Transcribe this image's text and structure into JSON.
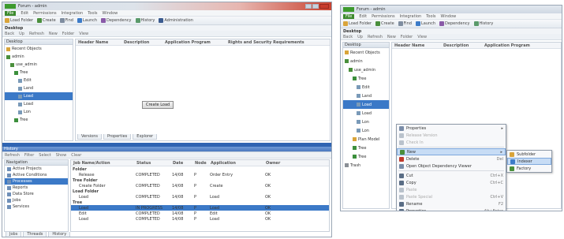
{
  "left_window": {
    "title": "Forum - admin",
    "menu": [
      "File",
      "Edit",
      "Permissions",
      "Integration",
      "Tools",
      "Window"
    ],
    "toolbar": [
      {
        "label": "Load Folder",
        "icon": "folder-icon",
        "color": "#d9a43a"
      },
      {
        "label": "Create",
        "icon": "create-icon",
        "color": "#4a8f3c"
      },
      {
        "label": "Find",
        "icon": "find-icon",
        "color": "#7f8da0"
      },
      {
        "label": "Launch",
        "icon": "launch-icon",
        "color": "#3c7bc8"
      },
      {
        "label": "Dependency",
        "icon": "dependency-icon",
        "color": "#8a5aa8"
      },
      {
        "label": "History",
        "icon": "history-icon",
        "color": "#5a9a6a"
      },
      {
        "label": "Administration",
        "icon": "admin-icon",
        "color": "#3b5b8f"
      }
    ],
    "doc_title": "Desktop",
    "subtoolbar": [
      "Back",
      "Up",
      "Refresh",
      "New",
      "Folder",
      "View"
    ],
    "tree_header": "Desktop",
    "tree": [
      {
        "label": "Recent Objects",
        "icon": "recent-icon",
        "color": "#d9a43a",
        "indent": 0
      },
      {
        "label": "admin",
        "icon": "user-folder-icon",
        "color": "#4a8f3c",
        "indent": 0
      },
      {
        "label": "use_admin",
        "icon": "folder-icon",
        "color": "#4a8f3c",
        "indent": 1
      },
      {
        "label": "Tree",
        "icon": "tree-icon",
        "color": "#3c8f3c",
        "indent": 2
      },
      {
        "label": "Edit",
        "icon": "doc-icon",
        "color": "#7a9ab8",
        "indent": 3
      },
      {
        "label": "Land",
        "icon": "doc-icon",
        "color": "#7a9ab8",
        "indent": 3
      },
      {
        "label": "Load",
        "icon": "doc-icon",
        "color": "#7a9ab8",
        "indent": 3,
        "selected": true
      },
      {
        "label": "Load",
        "icon": "doc-icon",
        "color": "#7a9ab8",
        "indent": 3
      },
      {
        "label": "Lon",
        "icon": "doc-icon",
        "color": "#7a9ab8",
        "indent": 3
      },
      {
        "label": "Tree",
        "icon": "tree-icon",
        "color": "#3c8f3c",
        "indent": 2
      }
    ],
    "list_columns": [
      "Header Name",
      "Description",
      "Application Program",
      "Rights and Security Requirements"
    ],
    "center_button": "Create Load",
    "bottom_tabs": [
      "Versions",
      "Properties",
      "Explorer"
    ],
    "lower_panel": {
      "title": "History",
      "toolbar": [
        "Refresh",
        "Filter",
        "Select",
        "Show",
        "Clear"
      ],
      "nav_header": "Navigation",
      "nav_items": [
        "Active Projects",
        "Active Conditions",
        "Processes",
        "Reports",
        "Data Store",
        "Jobs",
        "Services"
      ],
      "columns": [
        "Job Name/Action",
        "Status",
        "Date",
        "Node",
        "Application",
        "Owner"
      ],
      "rows": [
        {
          "group": true,
          "cells": [
            "Folder"
          ]
        },
        {
          "group": false,
          "cells": [
            "Release",
            "COMPLETED",
            "14/08",
            "P",
            "Order Entry",
            "OK"
          ]
        },
        {
          "group": true,
          "cells": [
            "Tree Folder"
          ]
        },
        {
          "group": false,
          "cells": [
            "Create Folder",
            "COMPLETED",
            "14/08",
            "P",
            "Create",
            "OK"
          ]
        },
        {
          "group": true,
          "cells": [
            "Load Folder"
          ]
        },
        {
          "group": false,
          "cells": [
            "Load",
            "COMPLETED",
            "14/08",
            "P",
            "Load",
            "OK"
          ]
        },
        {
          "group": true,
          "cells": [
            "Tree"
          ]
        },
        {
          "group": false,
          "cells": [
            "Load",
            "IN PROGRESS",
            "14/08",
            "P",
            "Load",
            "OK"
          ],
          "selected": true
        },
        {
          "group": false,
          "cells": [
            "Edit",
            "COMPLETED",
            "14/08",
            "P",
            "Edit",
            "OK"
          ]
        },
        {
          "group": false,
          "cells": [
            "Load",
            "COMPLETED",
            "14/08",
            "P",
            "Load",
            "OK"
          ]
        }
      ],
      "status_tabs": [
        "Jobs",
        "Threads",
        "History"
      ]
    }
  },
  "right_window": {
    "title": "Forum - admin",
    "menu": [
      "File",
      "Edit",
      "Permissions",
      "Integration",
      "Tools",
      "Window"
    ],
    "toolbar": [
      {
        "label": "Load Folder",
        "icon": "folder-icon",
        "color": "#d9a43a"
      },
      {
        "label": "Create",
        "icon": "create-icon",
        "color": "#4a8f3c"
      },
      {
        "label": "Find",
        "icon": "find-icon",
        "color": "#7f8da0"
      },
      {
        "label": "Launch",
        "icon": "launch-icon",
        "color": "#3c7bc8"
      },
      {
        "label": "Dependency",
        "icon": "dependency-icon",
        "color": "#8a5aa8"
      },
      {
        "label": "History",
        "icon": "history-icon",
        "color": "#5a9a6a"
      }
    ],
    "doc_title": "Desktop",
    "subtoolbar": [
      "Back",
      "Up",
      "Refresh",
      "New",
      "Folder",
      "View"
    ],
    "tree_header": "Desktop",
    "tree": [
      {
        "label": "Recent Objects",
        "icon": "recent-icon",
        "color": "#d9a43a",
        "indent": 0
      },
      {
        "label": "admin",
        "icon": "user-folder-icon",
        "color": "#4a8f3c",
        "indent": 0
      },
      {
        "label": "use_admin",
        "icon": "folder-icon",
        "color": "#4a8f3c",
        "indent": 1
      },
      {
        "label": "Tree",
        "icon": "tree-icon",
        "color": "#3c8f3c",
        "indent": 2
      },
      {
        "label": "Edit",
        "icon": "doc-icon",
        "color": "#7a9ab8",
        "indent": 3
      },
      {
        "label": "Land",
        "icon": "doc-icon",
        "color": "#7a9ab8",
        "indent": 3
      },
      {
        "label": "Load",
        "icon": "doc-icon",
        "color": "#7a9ab8",
        "indent": 3,
        "selected": true
      },
      {
        "label": "Load",
        "icon": "doc-icon",
        "color": "#7a9ab8",
        "indent": 3
      },
      {
        "label": "Lon",
        "icon": "doc-icon",
        "color": "#7a9ab8",
        "indent": 3
      },
      {
        "label": "Lon",
        "icon": "doc-icon",
        "color": "#7a9ab8",
        "indent": 3
      },
      {
        "label": "Plan Model",
        "icon": "model-icon",
        "color": "#d9a43a",
        "indent": 2
      },
      {
        "label": "Tree",
        "icon": "tree-icon",
        "color": "#3c8f3c",
        "indent": 2
      },
      {
        "label": "Tree",
        "icon": "tree-icon",
        "color": "#3c8f3c",
        "indent": 2
      },
      {
        "label": "Trash",
        "icon": "trash-icon",
        "color": "#8a8f96",
        "indent": 0
      }
    ],
    "list_columns": [
      "Header Name",
      "Description",
      "Application Program"
    ],
    "context_menu": [
      {
        "label": "Properties",
        "icon": "properties-icon",
        "color": "#7a8da8",
        "arrow": true
      },
      {
        "label": "Release Version",
        "icon": "release-icon",
        "color": "#b9c2cc",
        "dim": true
      },
      {
        "label": "Check In",
        "icon": "check-in-icon",
        "color": "#b9c2cc",
        "dim": true
      },
      {
        "sep": true
      },
      {
        "label": "New",
        "icon": "new-icon",
        "color": "#4a8f3c",
        "arrow": true,
        "highlight": true
      },
      {
        "label": "Delete",
        "icon": "delete-icon",
        "color": "#c0392b",
        "shortcut": "Del"
      },
      {
        "label": "Open Object Dependency Viewer",
        "icon": "viewer-icon",
        "color": "#7a8da8"
      },
      {
        "sep": true
      },
      {
        "label": "Cut",
        "icon": "cut-icon",
        "color": "#5a6d85",
        "shortcut": "Ctrl+X"
      },
      {
        "label": "Copy",
        "icon": "copy-icon",
        "color": "#5a6d85",
        "shortcut": "Ctrl+C"
      },
      {
        "label": "Paste",
        "icon": "paste-icon",
        "color": "#b9c2cc",
        "dim": true
      },
      {
        "label": "Paste Special",
        "icon": "paste-special-icon",
        "color": "#b9c2cc",
        "dim": true,
        "shortcut": "Ctrl+V"
      },
      {
        "label": "Rename",
        "icon": "rename-icon",
        "color": "#5a6d85",
        "shortcut": "F2"
      },
      {
        "label": "Properties",
        "icon": "properties-icon",
        "color": "#5a6d85",
        "shortcut": "Alt+Enter"
      }
    ],
    "submenu": [
      {
        "label": "Subfolder",
        "icon": "subfolder-icon",
        "color": "#d9a43a"
      },
      {
        "label": "Indexer",
        "icon": "indexer-icon",
        "color": "#3c7bc8",
        "highlight": true
      },
      {
        "label": "Factory",
        "icon": "factory-icon",
        "color": "#4a8f3c"
      }
    ]
  }
}
